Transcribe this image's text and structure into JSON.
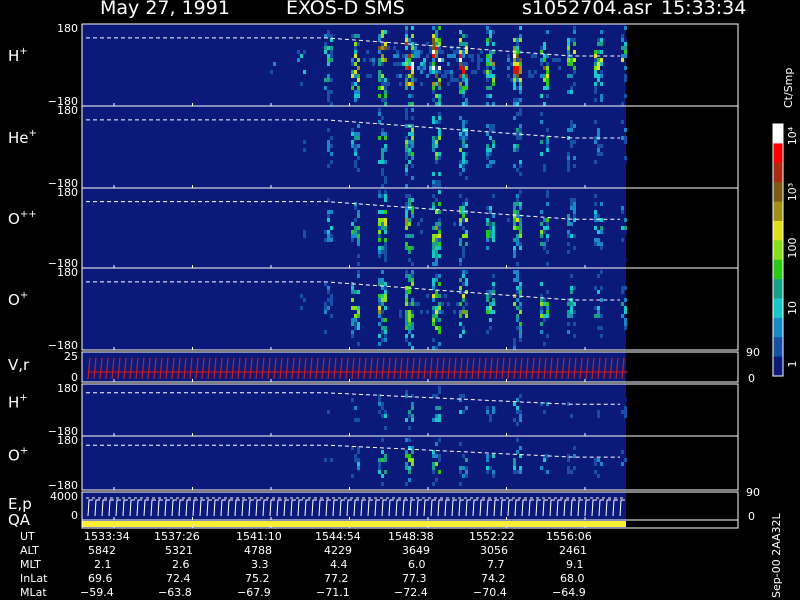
{
  "header": {
    "date": "May 27, 1991",
    "instrument": "EXOS-D SMS",
    "file": "s1052704.asr",
    "time": "15:33:34"
  },
  "colors": {
    "background": "#000000",
    "panel_bg": "#0b1a7a",
    "frame": "#ffffff",
    "trace": "#ffffff",
    "vel_marks": "#cc1e1e",
    "qa_bar": "#ffee33"
  },
  "colorbar": {
    "label": "Ct/Smp",
    "tick_labels": [
      "10⁴",
      "10³",
      "100",
      "10",
      "1"
    ],
    "colors": [
      "#ffffff",
      "#ff0000",
      "#aa2a14",
      "#7a5a14",
      "#a09018",
      "#e0e018",
      "#8ae018",
      "#2cc818",
      "#18a088",
      "#18c8c8",
      "#1888c8",
      "#1850a8",
      "#0b1a7a"
    ]
  },
  "panels": [
    {
      "id": "hplus",
      "label": "H",
      "sup": "+",
      "ytop": "180",
      "ybot": "−180"
    },
    {
      "id": "heplus",
      "label": "He",
      "sup": "+",
      "ytop": "180",
      "ybot": "−180"
    },
    {
      "id": "opp",
      "label": "O",
      "sup": "++",
      "ytop": "180",
      "ybot": "−180"
    },
    {
      "id": "oplus",
      "label": "O",
      "sup": "+",
      "ytop": "180",
      "ybot": "−180"
    },
    {
      "id": "vr",
      "label": "V,r",
      "sup": "",
      "ytop": "25",
      "ybot": "0",
      "rtop": "90",
      "rbot": "0"
    },
    {
      "id": "hplus2",
      "label": "H",
      "sup": "+",
      "ytop": "180",
      "ybot": "−180"
    },
    {
      "id": "oplus2",
      "label": "O",
      "sup": "+",
      "ytop": "180",
      "ybot": "−180"
    },
    {
      "id": "ep",
      "label": "E,p",
      "sup": "",
      "ytop": "4000",
      "ybot": "0",
      "rtop": "90",
      "rbot": "0"
    },
    {
      "id": "qa",
      "label": "QA",
      "sup": "",
      "ytop": "",
      "ybot": ""
    }
  ],
  "footer": {
    "rows": [
      {
        "label": "UT",
        "values": [
          "1533:34",
          "1537:26",
          "1541:10",
          "1544:54",
          "1548:38",
          "1552:22",
          "1556:06"
        ]
      },
      {
        "label": "ALT",
        "values": [
          "5842",
          "5321",
          "4788",
          "4229",
          "3649",
          "3056",
          "2461"
        ]
      },
      {
        "label": "MLT",
        "values": [
          "2.1",
          "2.6",
          "3.3",
          "4.4",
          "6.0",
          "7.7",
          "9.1"
        ]
      },
      {
        "label": "InLat",
        "values": [
          "69.6",
          "72.4",
          "75.2",
          "77.2",
          "77.3",
          "74.2",
          "68.0"
        ]
      },
      {
        "label": "MLat",
        "values": [
          "−59.4",
          "−63.8",
          "−67.9",
          "−71.1",
          "−72.4",
          "−70.4",
          "−64.9"
        ]
      }
    ],
    "gen_id": "Sep-00 2AA32L"
  },
  "chart_data": {
    "type": "heatmap",
    "title": "May 27, 1991   EXOS-D SMS",
    "x_label": "UT",
    "x_ticks": [
      "1533:34",
      "1537:26",
      "1541:10",
      "1544:54",
      "1548:38",
      "1552:22",
      "1556:06"
    ],
    "panels": [
      "H+",
      "He+",
      "O++",
      "O+",
      "V,r",
      "H+",
      "O+",
      "E,p",
      "QA"
    ],
    "pitch_angle_range": [
      -180,
      180
    ],
    "colorbar_range": [
      1,
      10000
    ],
    "colorbar_scale": "log",
    "colorbar_unit": "Ct/Smp",
    "data_coverage_end": "~1557:40"
  }
}
